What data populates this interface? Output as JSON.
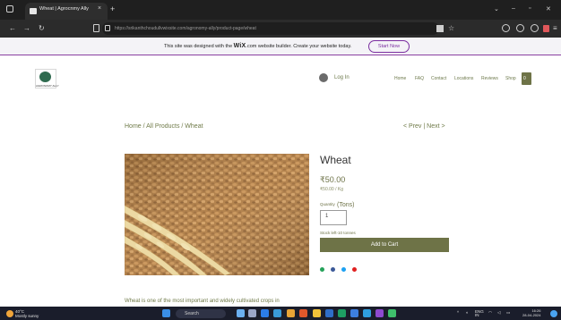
{
  "browser": {
    "tab_title": "Wheat | Agrocnmy Ally",
    "tab_close": "×",
    "new_tab": "+",
    "url": "https://srikanthchoudullvwixsite.com/agronomy-ally/product-page/wheat",
    "colors": {
      "tabbar": "#1f1f1f",
      "addressbar": "#2b2b2b"
    }
  },
  "wix_banner": {
    "text_prefix": "This site was designed with the",
    "wix": "WiX",
    "text_suffix": ".com website builder. Create your website today.",
    "cta": "Start Now",
    "accent": "#7b2fa0"
  },
  "header": {
    "logo_text": "AGRONOMY ALLY",
    "login": "Log In",
    "nav": [
      "Home",
      "FAQ",
      "Contact",
      "Locations",
      "Reviews",
      "Shop"
    ],
    "cart_count": "0"
  },
  "breadcrumb": "Home / All Products / Wheat",
  "pager": "< Prev | Next >",
  "product": {
    "name": "Wheat",
    "price": "₹50.00",
    "unit_price": "₹50.00 / Kg",
    "quantity_label": "Quantity",
    "quantity_unit": "(Tons)",
    "quantity": "1",
    "stock": "Stock left-10 tonnes",
    "add_to_cart": "Add to Cart",
    "accent": "#6e7347"
  },
  "description": "Wheat is one of the most important and widely cultivated crops in",
  "taskbar": {
    "temp": "40°C",
    "condition": "Mostly sunny",
    "search": "Search",
    "lang_top": "ENG",
    "lang_bottom": "IN",
    "time": "16:26",
    "date": "28-04-2024"
  }
}
